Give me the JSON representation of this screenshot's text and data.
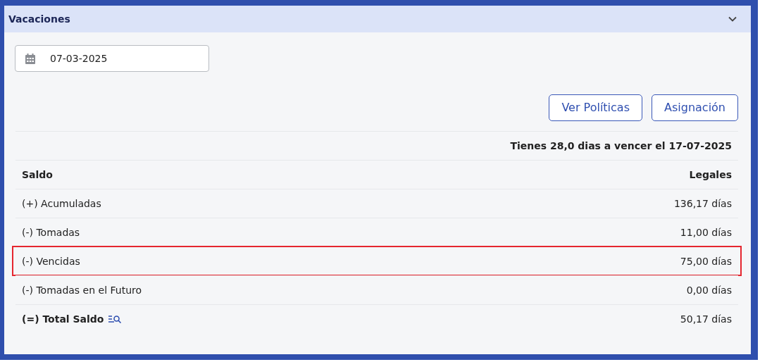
{
  "panel": {
    "title": "Vacaciones",
    "expanded": true
  },
  "date_field": {
    "value": "07-03-2025"
  },
  "buttons": [
    "Ver Políticas",
    "Asignación"
  ],
  "notice": "Tienes 28,0 dias a vencer el 17-07-2025",
  "table": {
    "columns": [
      "Saldo",
      "Legales"
    ],
    "rows": [
      {
        "label": "(+) Acumuladas",
        "value": "136,17 días",
        "highlighted": false,
        "kind": "normal"
      },
      {
        "label": "(-) Tomadas",
        "value": "11,00 días",
        "highlighted": false,
        "kind": "normal"
      },
      {
        "label": "(-) Vencidas",
        "value": "75,00 días",
        "highlighted": true,
        "kind": "normal"
      },
      {
        "label": "(-) Tomadas en el Futuro",
        "value": "0,00 días",
        "highlighted": false,
        "kind": "normal"
      },
      {
        "label": "(=) Total Saldo",
        "value": "50,17 días",
        "highlighted": false,
        "kind": "total"
      }
    ]
  }
}
